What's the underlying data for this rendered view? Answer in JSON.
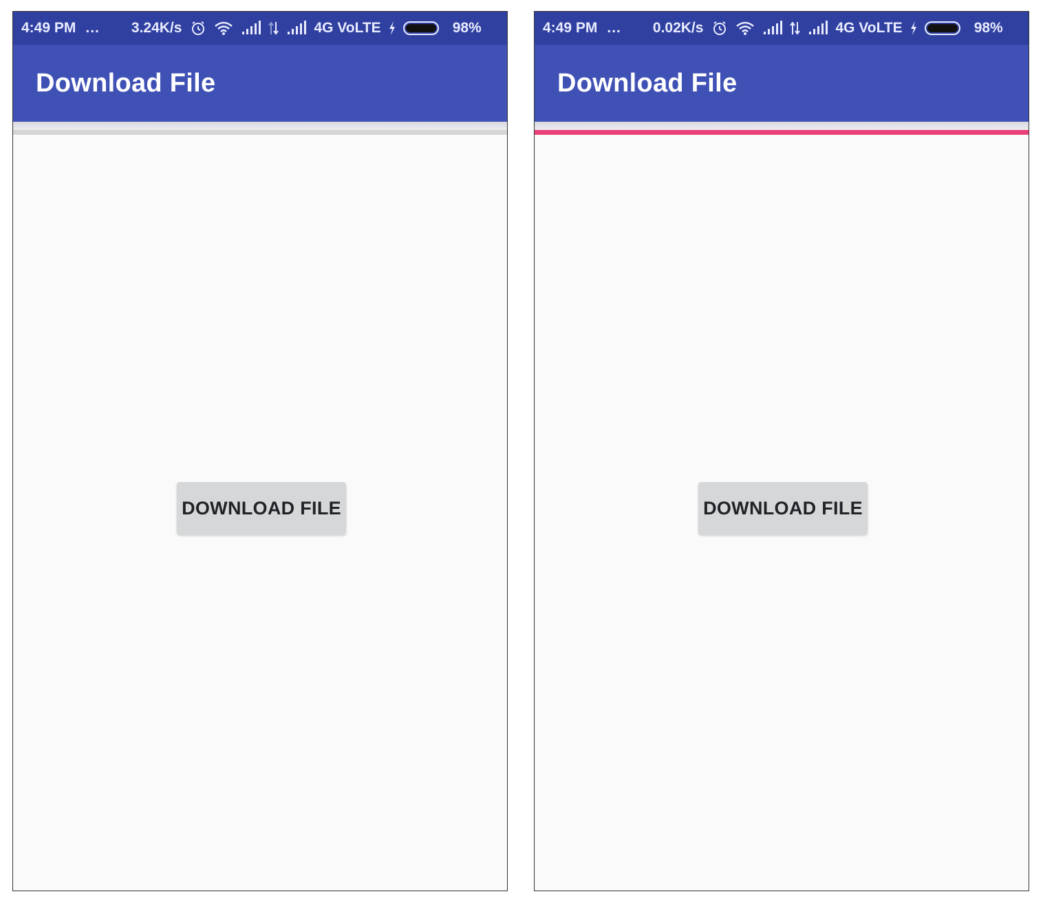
{
  "colors": {
    "status_bar": "#3040a0",
    "app_bar": "#3f51b5",
    "progress_track": "#d5d5d5",
    "progress_fill": "#ec407a",
    "button_bg": "#d6d7d9",
    "background": "#fafafa"
  },
  "screens": [
    {
      "status": {
        "time": "4:49 PM",
        "dots": "...",
        "speed": "3.24K/s",
        "icons": [
          "alarm-icon",
          "wifi-icon",
          "signal-icon",
          "data-arrows-icon",
          "signal-icon",
          "charging-icon",
          "battery-icon"
        ],
        "network": "4G VoLTE",
        "battery": "98%"
      },
      "title": "Download File",
      "progress": 0,
      "button_label": "DOWNLOAD FILE"
    },
    {
      "status": {
        "time": "4:49 PM",
        "dots": "...",
        "speed": "0.02K/s",
        "icons": [
          "alarm-icon",
          "wifi-icon",
          "signal-icon",
          "data-arrows-icon",
          "signal-icon",
          "charging-icon",
          "battery-icon"
        ],
        "network": "4G VoLTE",
        "battery": "98%"
      },
      "title": "Download File",
      "progress": 1,
      "button_label": "DOWNLOAD FILE"
    }
  ]
}
